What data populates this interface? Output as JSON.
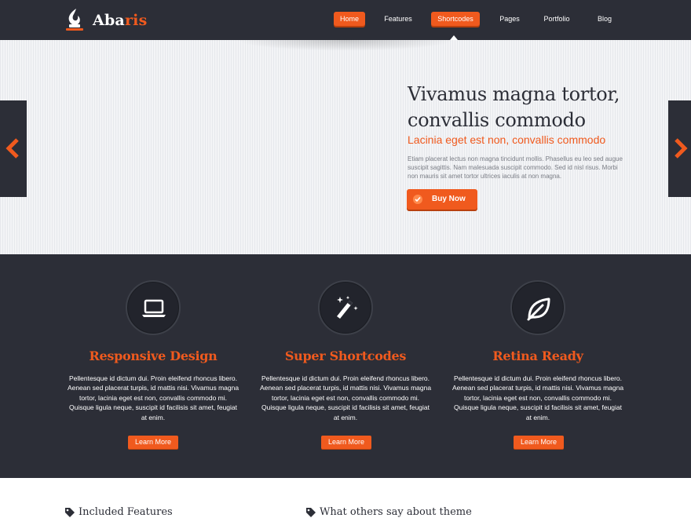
{
  "logo": {
    "text_main": "Aba",
    "text_accent": "ris",
    "icon": "flame-logo-icon"
  },
  "nav": {
    "items": [
      {
        "label": "Home",
        "active": true
      },
      {
        "label": "Features",
        "active": false
      },
      {
        "label": "Shortcodes",
        "active": true
      },
      {
        "label": "Pages",
        "active": false
      },
      {
        "label": "Portfolio",
        "active": false
      },
      {
        "label": "Blog",
        "active": false
      }
    ]
  },
  "hero": {
    "title": "Vivamus magna tortor, convallis commodo",
    "subtitle": "Lacinia eget est non, convallis commodo",
    "text": "Etiam placerat lectus non magna tincidunt mollis. Phasellus eu leo sed augue suscipit sagittis. Nam malesuada suscipit commodo. Sed id nisl risus. Morbi non mauris sit amet tortor ultrices iaculis at non magna.",
    "button_label": "Buy Now",
    "prev_icon": "chevron-left-icon",
    "next_icon": "chevron-right-icon"
  },
  "features": [
    {
      "icon": "laptop-icon",
      "title": "Responsive Design",
      "text": "Pellentesque id dictum dui. Proin eleifend rhoncus libero. Aenean sed placerat turpis, id mattis nisi. Vivamus magna tortor, lacinia eget est non, convallis commodo mi. Quisque ligula neque, suscipit id facilisis sit amet, feugiat at enim.",
      "button_label": "Learn More"
    },
    {
      "icon": "magic-wand-icon",
      "title": "Super Shortcodes",
      "text": "Pellentesque id dictum dui. Proin eleifend rhoncus libero. Aenean sed placerat turpis, id mattis nisi. Vivamus magna tortor, lacinia eget est non, convallis commodo mi. Quisque ligula neque, suscipit id facilisis sit amet, feugiat at enim.",
      "button_label": "Learn More"
    },
    {
      "icon": "leaf-icon",
      "title": "Retina Ready",
      "text": "Pellentesque id dictum dui. Proin eleifend rhoncus libero. Aenean sed placerat turpis, id mattis nisi. Vivamus magna tortor, lacinia eget est non, convallis commodo mi. Quisque ligula neque, suscipit id facilisis sit amet, feugiat at enim.",
      "button_label": "Learn More"
    }
  ],
  "bottom": {
    "headings": [
      {
        "icon": "tag-icon",
        "label": "Included Features"
      },
      {
        "icon": "tag-icon",
        "label": "What others say about theme"
      }
    ]
  },
  "colors": {
    "accent": "#f05a1e",
    "dark": "#2c2e37",
    "hero_bg": "#eef0f3"
  }
}
